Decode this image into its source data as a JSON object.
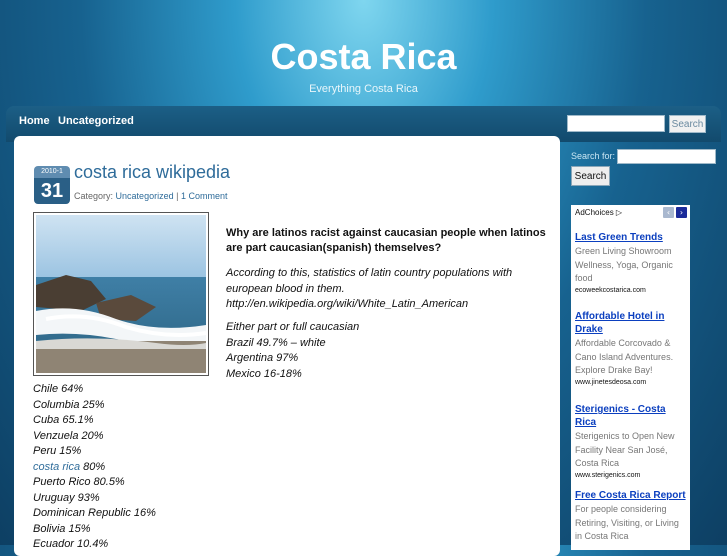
{
  "header": {
    "title": "Costa Rica",
    "description": "Everything Costa Rica"
  },
  "nav": {
    "items": [
      "Home",
      "Uncategorized"
    ]
  },
  "top_search": {
    "button_label": "Search"
  },
  "sidebar": {
    "search_label": "Search for:",
    "search_button": "Search"
  },
  "post": {
    "date_year": "2010-1",
    "date_day": "31",
    "title": "costa rica wikipedia",
    "meta_prefix": "Category:",
    "category": "Uncategorized",
    "separator": "|",
    "comments": "1 Comment",
    "question": "Why are latinos racist against caucasian people when latinos are part caucasian(spanish) themselves?",
    "para1": "According to this, statistics of latin country populations with european blood in them.",
    "para1_url": "http://en.wikipedia.org/wiki/White_Latin_American",
    "para2": [
      "Either part or full caucasian",
      "Brazil 49.7% – white",
      "Argentina 97%",
      "Mexico 16-18%"
    ],
    "stats": [
      "Chile 64%",
      "Columbia 25%",
      "Cuba 65.1%",
      "Venzuela 20%",
      "Peru 15%"
    ],
    "stats_link": "costa rica",
    "stats_link_value": "80%",
    "stats2": [
      "Puerto Rico 80.5%",
      "Uruguay 93%",
      "Dominican Republic 16%",
      "Bolivia 15%",
      "Ecuador 10.4%"
    ]
  },
  "ads": {
    "adchoices_label": "AdChoices",
    "items": [
      {
        "title": "Last Green Trends",
        "text": "Green Living Showroom Wellness, Yoga, Organic food",
        "url": "ecoweekcostarica.com"
      },
      {
        "title": "Affordable Hotel in Drake",
        "text": "Affordable Corcovado & Cano Island Adventures. Explore Drake Bay!",
        "url": "www.jinetesdeosa.com"
      },
      {
        "title": "Sterigenics - Costa Rica",
        "text": "Sterigenics to Open New Facility Near San José, Costa Rica",
        "url": "www.sterigenics.com"
      },
      {
        "title": "Free Costa Rica Report",
        "text": "For people considering Retiring, Visiting, or Living in Costa Rica",
        "url": ""
      }
    ]
  },
  "colors": {
    "link": "#2f6c9a",
    "ad_link": "#0b3fbf",
    "nav_bar": "#124a6d"
  }
}
